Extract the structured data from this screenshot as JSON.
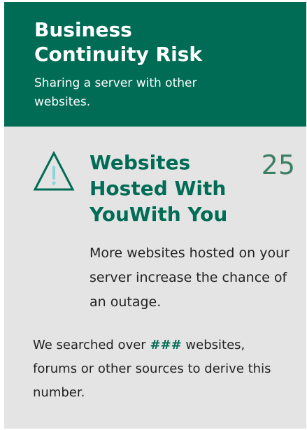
{
  "header": {
    "title": "Business Continuity Risk",
    "subtitle": "Sharing a server with other websites."
  },
  "metric": {
    "icon": "warning-icon",
    "label": "Websites Hosted With YouWith You",
    "value": "25",
    "description": "More websites hosted on your server increase the chance of an outage."
  },
  "source": {
    "prefix": "We searched over",
    "count": "###",
    "suffix": "websites, forums or other sources to derive this number."
  },
  "colors": {
    "brand_green": "#006c55",
    "value_green": "#3d7f64",
    "card_background": "#e4e4e4",
    "icon_accent": "#8fd3de"
  }
}
